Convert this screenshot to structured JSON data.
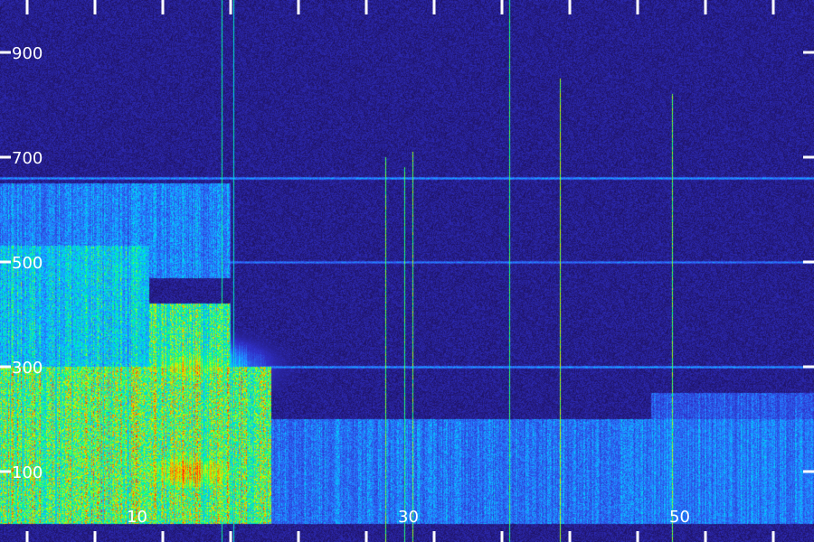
{
  "chart_data": {
    "type": "heatmap",
    "title": "",
    "xlabel": "",
    "ylabel": "",
    "x_ticks": [
      10,
      30,
      50
    ],
    "y_ticks": [
      100,
      300,
      500,
      700,
      900
    ],
    "xlim": [
      0,
      60
    ],
    "ylim": [
      0,
      1000
    ],
    "grid": false,
    "colormap": [
      "#1e1262",
      "#3030c8",
      "#2878ff",
      "#00d2ff",
      "#00ff82",
      "#c8ff00",
      "#ffa000",
      "#ff2800"
    ],
    "bright_regions": [
      {
        "x0": 0,
        "x1": 20,
        "y0": 0,
        "y1": 300,
        "intensity": 0.62
      },
      {
        "x0": 0,
        "x1": 11,
        "y0": 280,
        "y1": 530,
        "intensity": 0.42
      },
      {
        "x0": 11,
        "x1": 17,
        "y0": 290,
        "y1": 420,
        "intensity": 0.55
      },
      {
        "x0": 0,
        "x1": 17,
        "y0": 470,
        "y1": 650,
        "intensity": 0.3
      },
      {
        "x0": 0,
        "x1": 60,
        "y0": 0,
        "y1": 200,
        "intensity": 0.28
      },
      {
        "x0": 48,
        "x1": 60,
        "y0": 0,
        "y1": 250,
        "intensity": 0.22
      }
    ],
    "hot_spots": [
      {
        "x": 14,
        "y": 100,
        "intensity": 0.85
      },
      {
        "x": 14,
        "y": 300,
        "intensity": 0.7
      }
    ],
    "horizontal_lines": [
      {
        "y": 300,
        "x0": 0,
        "x1": 60,
        "intensity": 0.35
      },
      {
        "y": 500,
        "x0": 0,
        "x1": 60,
        "intensity": 0.3
      },
      {
        "y": 660,
        "x0": 0,
        "x1": 60,
        "intensity": 0.35
      }
    ],
    "vertical_lines": [
      {
        "x": 16.3,
        "y_top": 1000,
        "intensity": 0.55
      },
      {
        "x": 17.2,
        "y_top": 1000,
        "intensity": 0.5
      },
      {
        "x": 28.4,
        "y_top": 700,
        "intensity": 0.65
      },
      {
        "x": 29.8,
        "y_top": 680,
        "intensity": 0.6
      },
      {
        "x": 30.4,
        "y_top": 710,
        "intensity": 0.65
      },
      {
        "x": 37.5,
        "y_top": 1000,
        "intensity": 0.6
      },
      {
        "x": 41.3,
        "y_top": 850,
        "intensity": 0.7
      },
      {
        "x": 49.5,
        "y_top": 820,
        "intensity": 0.65
      }
    ]
  }
}
